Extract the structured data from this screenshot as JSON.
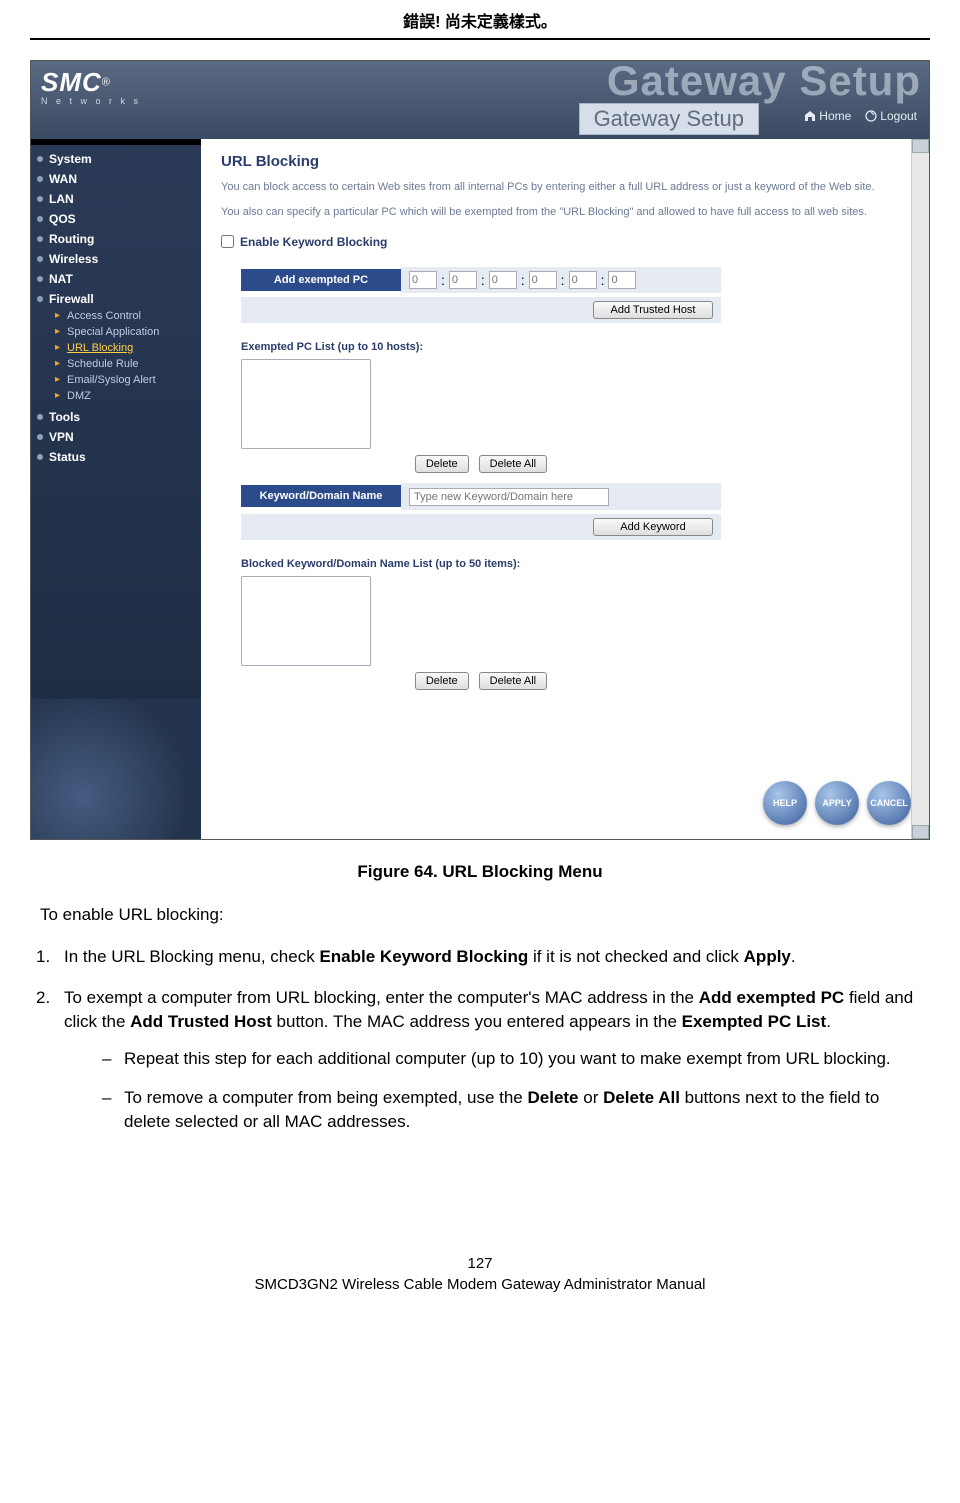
{
  "header": {
    "error_text": "錯誤! 尚未定義樣式。"
  },
  "screenshot": {
    "logo": {
      "brand": "SMC",
      "reg": "®",
      "sub": "N e t w o r k s"
    },
    "title_ghost": "Gateway Setup",
    "title_bar": "Gateway Setup",
    "top_links": {
      "home": "Home",
      "logout": "Logout"
    },
    "nav": {
      "items": [
        "System",
        "WAN",
        "LAN",
        "QOS",
        "Routing",
        "Wireless",
        "NAT",
        "Firewall",
        "Tools",
        "VPN",
        "Status"
      ],
      "firewall_sub": [
        "Access Control",
        "Special Application",
        "URL Blocking",
        "Schedule Rule",
        "Email/Syslog Alert",
        "DMZ"
      ],
      "active_sub_index": 2
    },
    "main": {
      "heading": "URL Blocking",
      "desc1": "You can block access to certain Web sites from all internal PCs by entering either a full URL address or just a keyword of the Web site.",
      "desc2": "You also can specify a particular PC which will be exempted from the \"URL Blocking\" and allowed to have full access to all web sites.",
      "enable_label": "Enable Keyword Blocking",
      "field_add_exempted": "Add exempted PC",
      "mac_placeholder": "0",
      "btn_add_trusted": "Add Trusted Host",
      "exempted_list_label": "Exempted PC List (up to 10 hosts):",
      "btn_delete": "Delete",
      "btn_delete_all": "Delete All",
      "field_keyword": "Keyword/Domain Name",
      "keyword_placeholder": "Type new Keyword/Domain here",
      "btn_add_keyword": "Add Keyword",
      "blocked_list_label": "Blocked Keyword/Domain Name List (up to 50 items):",
      "round_help": "HELP",
      "round_apply": "APPLY",
      "round_cancel": "CANCEL"
    }
  },
  "figure_caption": "Figure 64. URL Blocking Menu",
  "doc": {
    "intro": "To enable URL blocking:",
    "step1_a": "In the URL Blocking menu, check ",
    "step1_b": "Enable Keyword Blocking",
    "step1_c": " if it is not checked and click ",
    "step1_d": "Apply",
    "step1_e": ".",
    "step2_a": "To exempt a computer from URL blocking, enter the computer's MAC address in the ",
    "step2_b": "Add exempted PC",
    "step2_c": " field and click the ",
    "step2_d": "Add Trusted Host",
    "step2_e": " button. The MAC address you entered appears in the ",
    "step2_f": "Exempted PC List",
    "step2_g": ".",
    "sub1": "Repeat this step for each additional computer (up to 10) you want to make exempt from URL blocking.",
    "sub2_a": "To remove a computer from being exempted, use the ",
    "sub2_b": "Delete",
    "sub2_c": " or ",
    "sub2_d": "Delete All",
    "sub2_e": " buttons next to the field to delete selected or all MAC addresses."
  },
  "footer": {
    "page_num": "127",
    "manual_title": "SMCD3GN2 Wireless Cable Modem Gateway Administrator Manual"
  }
}
